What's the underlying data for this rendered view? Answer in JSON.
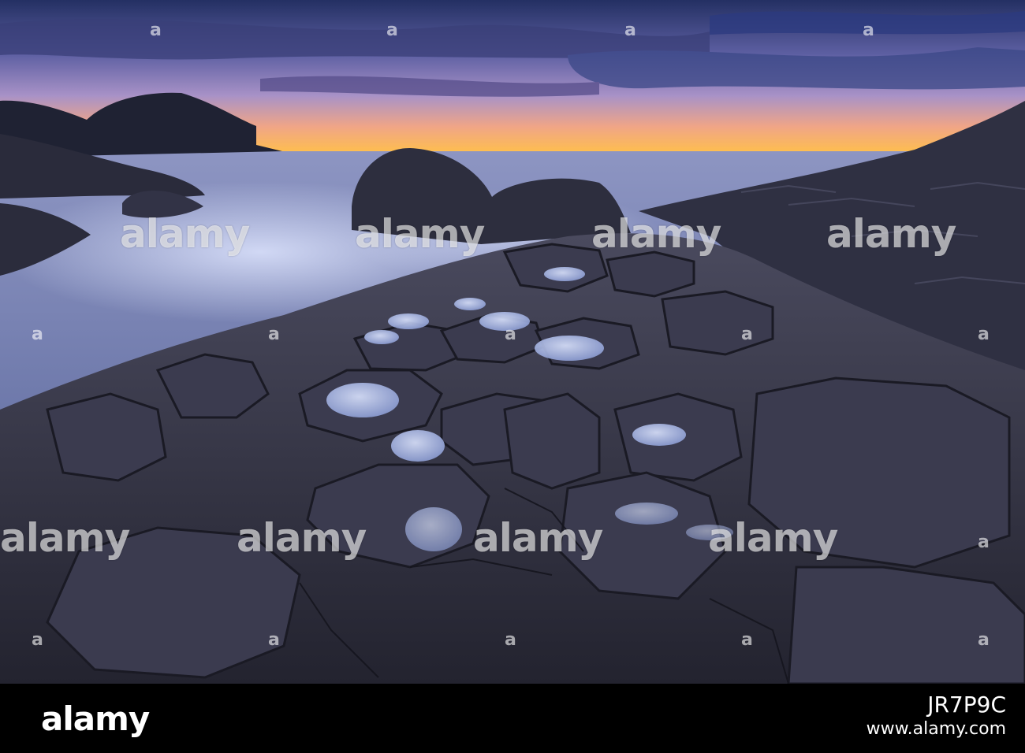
{
  "scene": {
    "colors": {
      "sky_top": "#2f3c72",
      "sky_mid": "#8d86c4",
      "sky_glow": "#f19a7a",
      "horizon": "#ffc24a",
      "sea": "#7b87b8",
      "rock": "#3a3a4c",
      "rock_dark": "#1e1f2b",
      "puddle": "#b7c6ee"
    }
  },
  "watermark": {
    "text": "alamy",
    "mark": "a"
  },
  "footer": {
    "logo": "alamy",
    "image_id": "JR7P9C",
    "url": "www.alamy.com"
  }
}
